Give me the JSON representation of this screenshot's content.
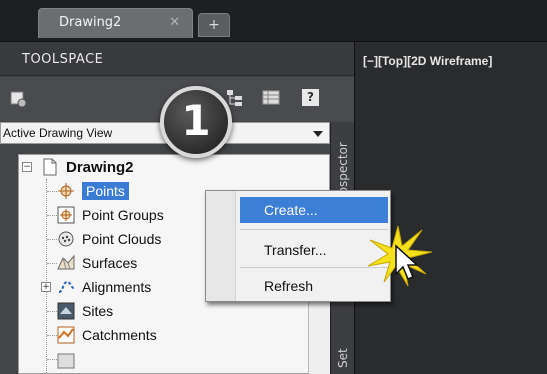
{
  "tabs": {
    "active_label": "Drawing2",
    "close_glyph": "✕",
    "add_glyph": "+"
  },
  "toolspace": {
    "title": "TOOLSPACE",
    "help_label": "?",
    "view_select": {
      "value": "Active Drawing View"
    },
    "side_tabs": [
      "Prospector",
      "Set"
    ]
  },
  "tree": {
    "root": {
      "label": "Drawing2",
      "expander": "−",
      "icon": "drawing-document-icon"
    },
    "items": [
      {
        "label": "Points",
        "icon": "points-icon",
        "selected": true
      },
      {
        "label": "Point Groups",
        "icon": "point-groups-icon"
      },
      {
        "label": "Point Clouds",
        "icon": "point-clouds-icon"
      },
      {
        "label": "Surfaces",
        "icon": "surfaces-icon"
      },
      {
        "label": "Alignments",
        "icon": "alignments-icon",
        "expander": "+"
      },
      {
        "label": "Sites",
        "icon": "sites-icon"
      },
      {
        "label": "Catchments",
        "icon": "catchments-icon"
      }
    ]
  },
  "viewport": {
    "label": "[−][Top][2D Wireframe]"
  },
  "context_menu": {
    "items": [
      {
        "label": "Create...",
        "highlighted": true
      },
      {
        "label": "Transfer..."
      },
      {
        "label": "Refresh"
      }
    ]
  },
  "callout": {
    "number": "1"
  },
  "colors": {
    "selection": "#3a7bd5",
    "panel": "#444548",
    "viewport": "#2a2b2d",
    "burst": "#f4e11b"
  }
}
